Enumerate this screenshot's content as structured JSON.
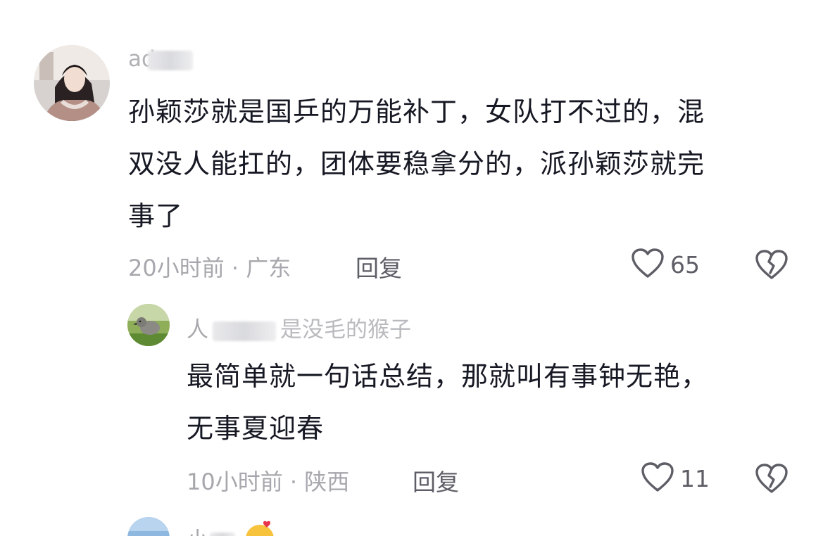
{
  "comments": [
    {
      "username_visible": "adu",
      "text_lines": [
        "孙颖莎就是国乒的万能补丁，女队打不过的，混",
        "双没人能扛的，团体要稳拿分的，派孙颖莎就完",
        "事了"
      ],
      "time": "20小时前",
      "location": "广东",
      "separator": "·",
      "reply_label": "回复",
      "likes": "65",
      "like_icon": "heart-outline-icon",
      "dislike_icon": "broken-heart-icon"
    },
    {
      "username_visible_start": "人",
      "username_visible_end": "是没毛的猴子",
      "text_lines": [
        "最简单就一句话总结，那就叫有事钟无艳，",
        "无事夏迎春"
      ],
      "time": "10小时前",
      "location": "陕西",
      "separator": "·",
      "reply_label": "回复",
      "likes": "11",
      "like_icon": "heart-outline-icon",
      "dislike_icon": "broken-heart-icon"
    },
    {
      "username_visible": "小",
      "emoji_icon": "smiling-face-with-hearts-icon"
    }
  ],
  "colors": {
    "text": "#161823",
    "muted": "#a7a8ad",
    "action": "#5d5e66",
    "icon": "#5d5e66"
  }
}
